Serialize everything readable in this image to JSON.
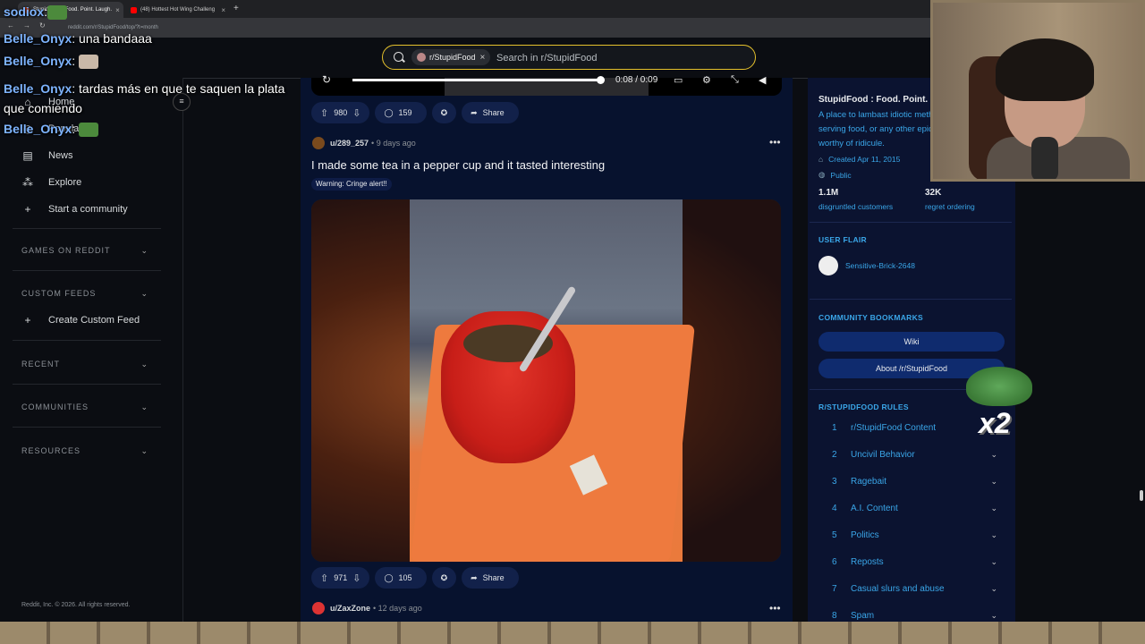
{
  "browser": {
    "tabs": [
      {
        "title": "StupidFood : Food. Point. Laugh."
      },
      {
        "title": "(48) Hottest Hot Wing Challeng"
      }
    ],
    "url": "reddit.com/r/StupidFood/top/?t=month"
  },
  "header": {
    "search_chip": "r/StupidFood",
    "search_placeholder": "Search in r/StupidFood"
  },
  "sidebar": {
    "items": [
      {
        "label": "Home",
        "icon": "home-icon"
      },
      {
        "label": "Popular",
        "icon": "popular-icon"
      },
      {
        "label": "News",
        "icon": "news-icon"
      },
      {
        "label": "Explore",
        "icon": "explore-icon"
      },
      {
        "label": "Start a community",
        "icon": "plus-icon"
      }
    ],
    "sections": {
      "games": "GAMES ON REDDIT",
      "custom_feeds": "CUSTOM FEEDS",
      "create_custom_feed": "Create Custom Feed",
      "recent": "RECENT",
      "communities": "COMMUNITIES",
      "resources": "RESOURCES"
    },
    "footer": "Reddit, Inc. © 2026. All rights reserved."
  },
  "video": {
    "time": "0:08 / 0:09"
  },
  "post1_actions": {
    "votes": "980",
    "comments": "159",
    "share": "Share"
  },
  "post2": {
    "author": "u/289_257",
    "age": "• 9 days ago",
    "title": "I made some tea in a pepper cup and it tasted interesting",
    "flair": "Warning: Cringe alert!!",
    "votes": "971",
    "comments": "105",
    "share": "Share"
  },
  "post3": {
    "author": "u/ZaxZone",
    "age": "• 12 days ago"
  },
  "community": {
    "title": "StupidFood : Food. Point. Laugh.",
    "description": "A place to lambast idiotic methods of serving food, or any other epicurean in worthy of ridicule.",
    "created": "Created Apr 11, 2015",
    "visibility": "Public",
    "members": "1.1M",
    "members_label": "disgruntled customers",
    "online": "32K",
    "online_label": "regret ordering"
  },
  "user_flair": {
    "heading": "USER FLAIR",
    "name": "Sensitive-Brick-2648"
  },
  "bookmarks": {
    "heading": "COMMUNITY BOOKMARKS",
    "items": [
      "Wiki",
      "About /r/StupidFood"
    ]
  },
  "rules": {
    "heading": "R/STUPIDFOOD RULES",
    "items": [
      {
        "n": "1",
        "label": "r/StupidFood Content"
      },
      {
        "n": "2",
        "label": "Uncivil Behavior"
      },
      {
        "n": "3",
        "label": "Ragebait"
      },
      {
        "n": "4",
        "label": "A.I. Content"
      },
      {
        "n": "5",
        "label": "Politics"
      },
      {
        "n": "6",
        "label": "Reposts"
      },
      {
        "n": "7",
        "label": "Casual slurs and abuse"
      },
      {
        "n": "8",
        "label": "Spam"
      }
    ]
  },
  "chat": [
    {
      "name": "sodiox",
      "message": ""
    },
    {
      "name": "Belle_Onyx",
      "message": "una bandaaa"
    },
    {
      "name": "Belle_Onyx",
      "message": ""
    },
    {
      "name": "Belle_Onyx",
      "message": "tardas más en que te saquen la plata que comiendo"
    },
    {
      "name": "Belle_Onyx",
      "message": ""
    }
  ],
  "overlay": {
    "multiplier": "x2"
  }
}
